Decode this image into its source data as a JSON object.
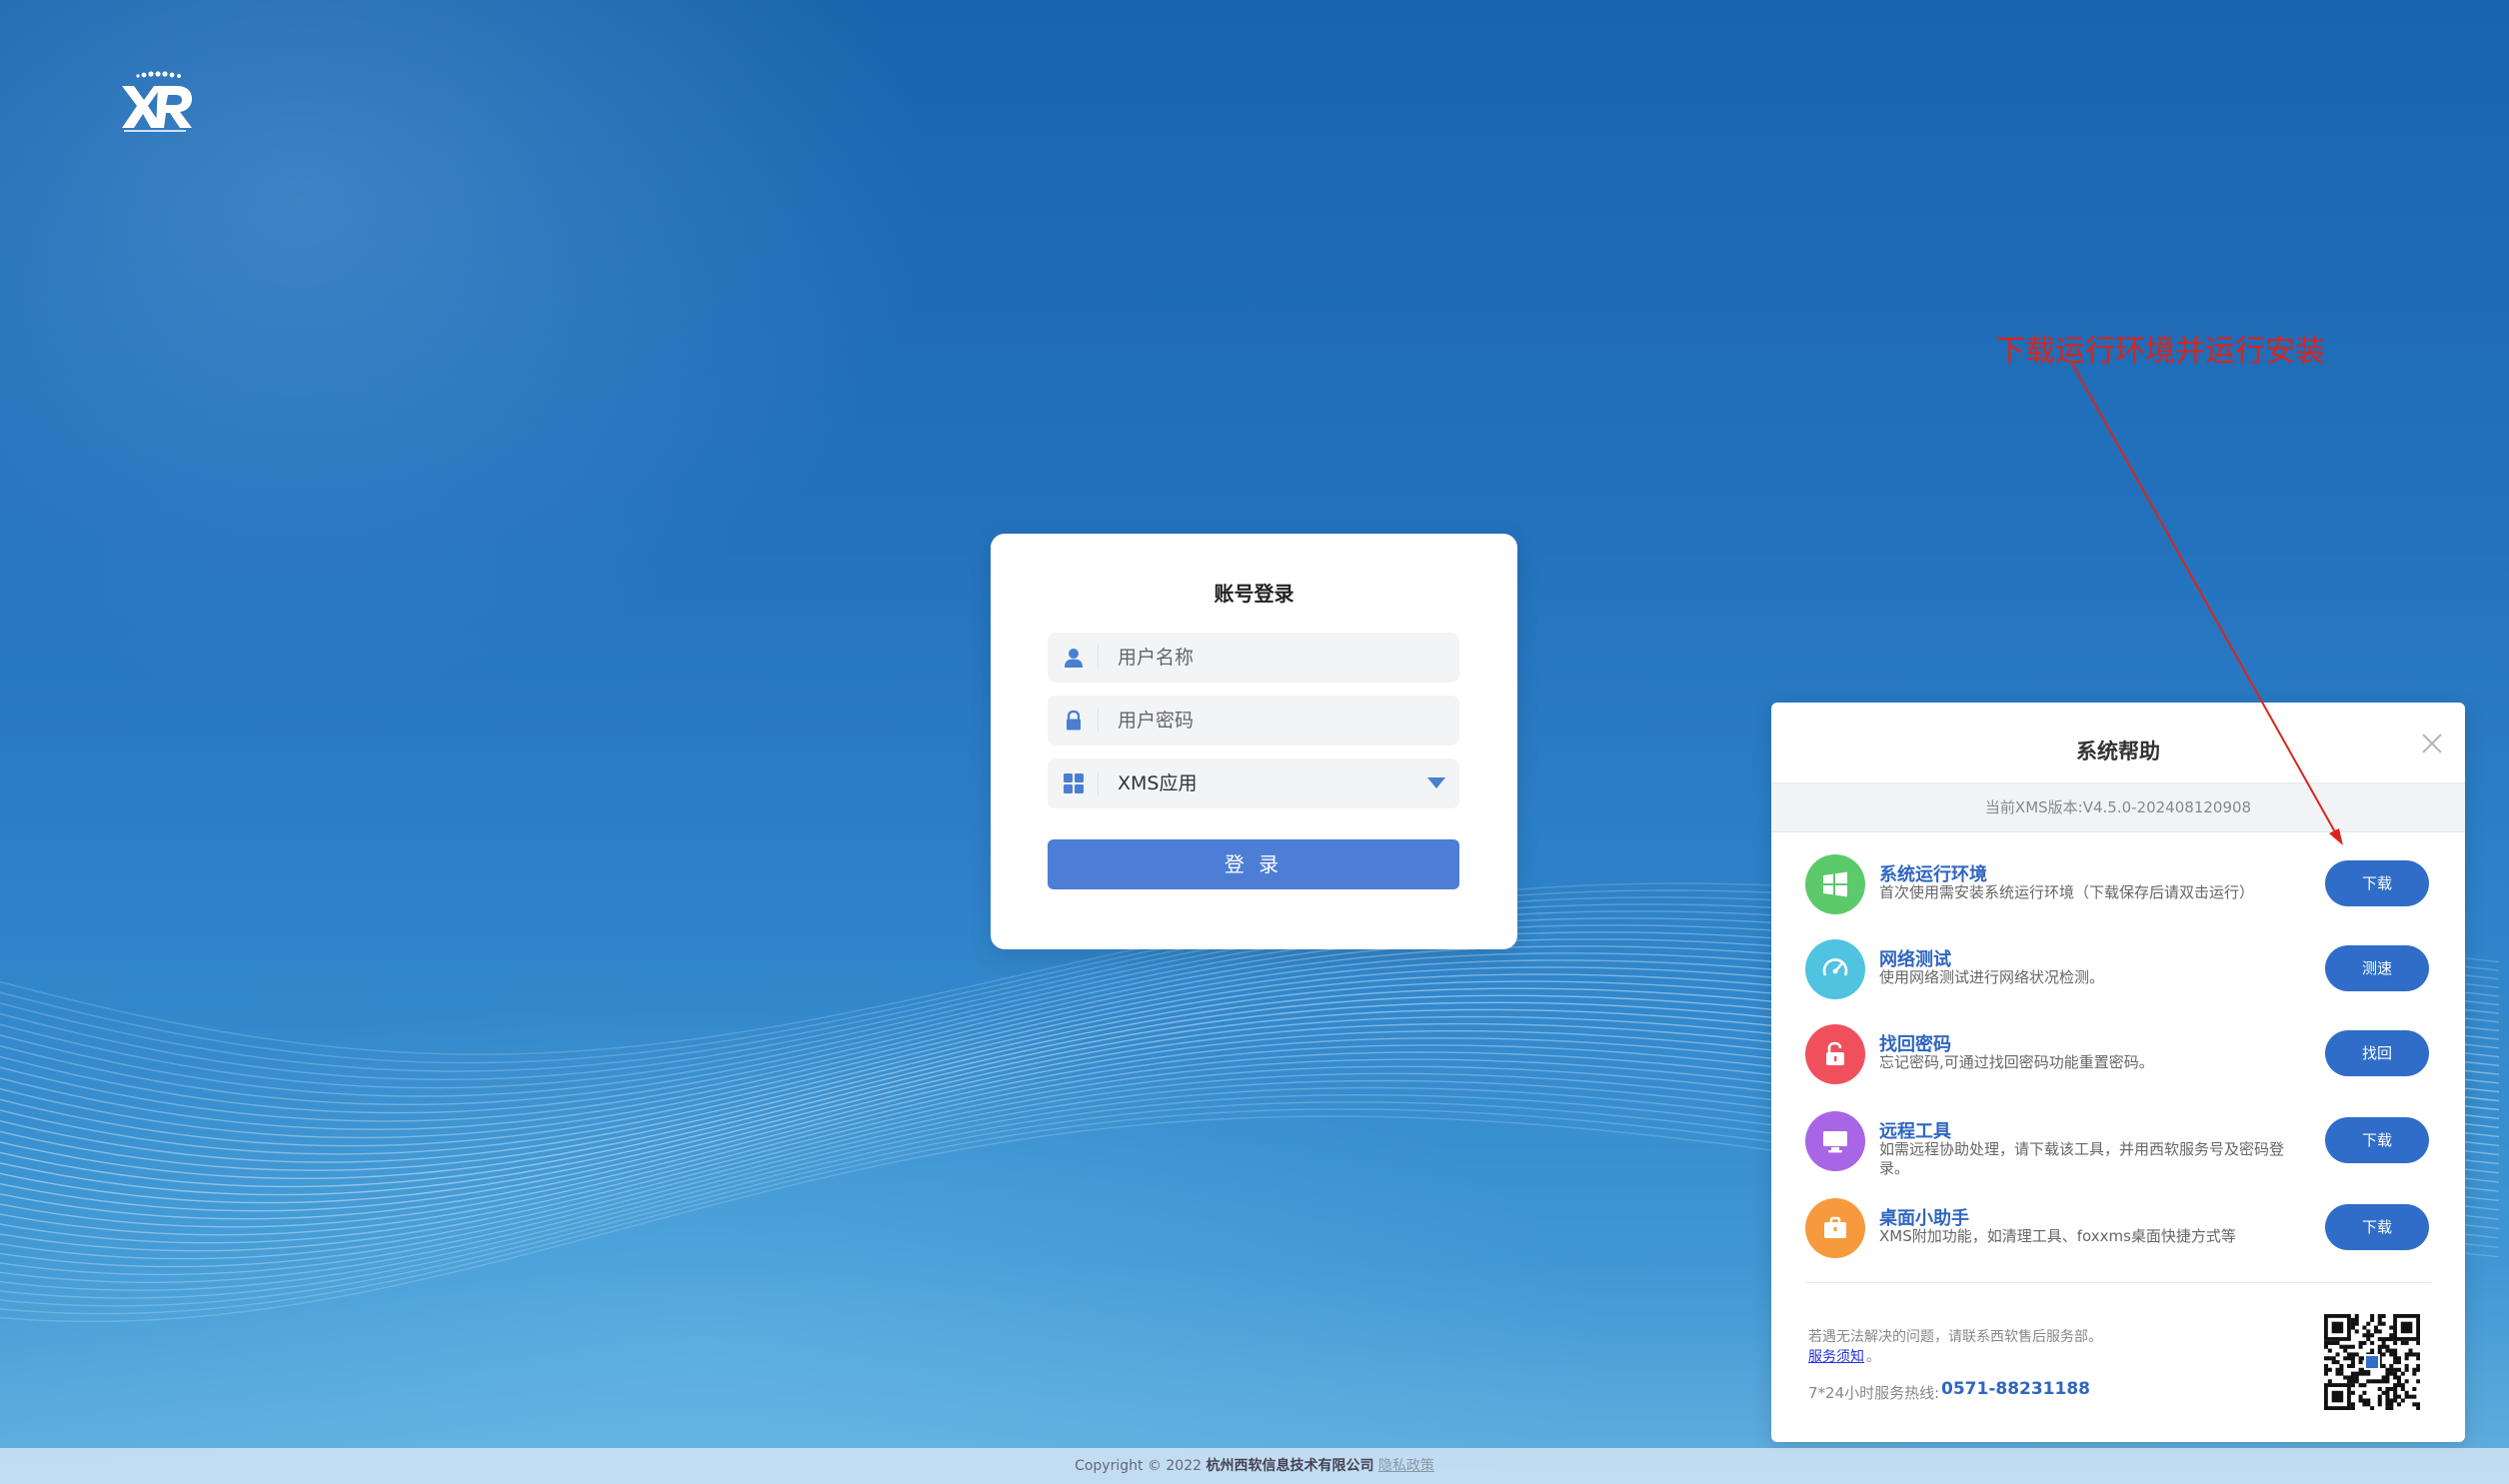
{
  "login": {
    "title": "账号登录",
    "username_placeholder": "用户名称",
    "password_placeholder": "用户密码",
    "app_select_value": "XMS应用",
    "submit_label": "登 录"
  },
  "help_panel": {
    "title": "系统帮助",
    "version": "当前XMS版本:V4.5.0-202408120908",
    "items": [
      {
        "title": "系统运行环境",
        "desc": "首次使用需安装系统运行环境（下载保存后请双击运行）",
        "button": "下载",
        "icon": "windows-icon",
        "color": "#5cc96a"
      },
      {
        "title": "网络测试",
        "desc": "使用网络测试进行网络状况检测。",
        "button": "测速",
        "icon": "speedometer-icon",
        "color": "#4fc3e0"
      },
      {
        "title": "找回密码",
        "desc": "忘记密码,可通过找回密码功能重置密码。",
        "button": "找回",
        "icon": "unlock-icon",
        "color": "#f0505c"
      },
      {
        "title": "远程工具",
        "desc": "如需远程协助处理，请下载该工具，并用西软服务号及密码登录。",
        "button": "下载",
        "icon": "monitor-icon",
        "color": "#a866e6"
      },
      {
        "title": "桌面小助手",
        "desc": "XMS附加功能，如清理工具、foxxms桌面快捷方式等",
        "button": "下载",
        "icon": "toolbox-icon",
        "color": "#f79a3e"
      }
    ],
    "footer_text": "若遇无法解决的问题，请联系西软售后服务部。",
    "service_link": "服务须知",
    "service_link_suffix": "。",
    "hotline_label": "7*24小时服务热线:",
    "hotline": "0571-88231188"
  },
  "annotation": {
    "text": "下载运行环境并运行安装"
  },
  "footer": {
    "copyright": "Copyright © 2022",
    "company": "杭州西软信息技术有限公司",
    "privacy": "隐私政策"
  }
}
